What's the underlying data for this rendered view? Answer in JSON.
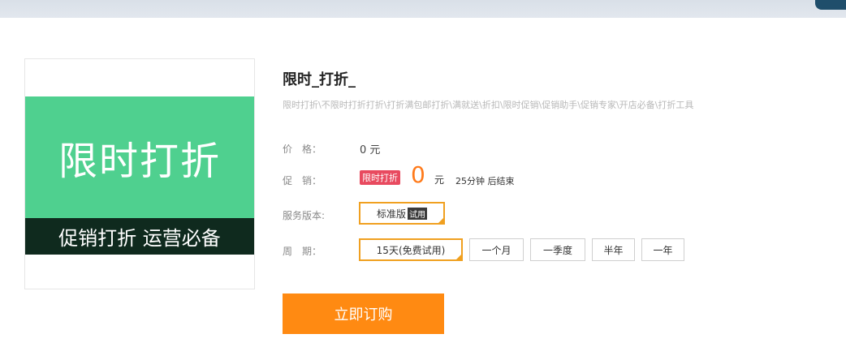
{
  "product": {
    "image": {
      "banner_title": "限时打折",
      "banner_subtitle": "促销打折 运营必备"
    },
    "title": "限时_打折_",
    "keywords": "限时打折\\不限时打折打折\\打折满包邮打折\\满就送\\折扣\\限时促销\\促销助手\\促销专家\\开店必备\\打折工具"
  },
  "price": {
    "label": "价　格：",
    "value": "0 元"
  },
  "promotion": {
    "label": "促　销：",
    "badge": "限时打折",
    "amount": "0",
    "unit": "元",
    "countdown": "25分钟 后结束"
  },
  "version": {
    "label": "服务版本:",
    "option": "标准版",
    "tag": "试用"
  },
  "period": {
    "label": "周　期：",
    "options": [
      "15天(免费试用)",
      "一个月",
      "一季度",
      "半年",
      "一年"
    ],
    "selected": "15天(免费试用)"
  },
  "buy_button": "立即订购",
  "colors": {
    "banner_green": "#4fd08f",
    "banner_dark": "#0f2a1e",
    "accent_orange": "#ff8a12",
    "badge_red": "#e84a5f",
    "selected_border": "#f0a020"
  }
}
